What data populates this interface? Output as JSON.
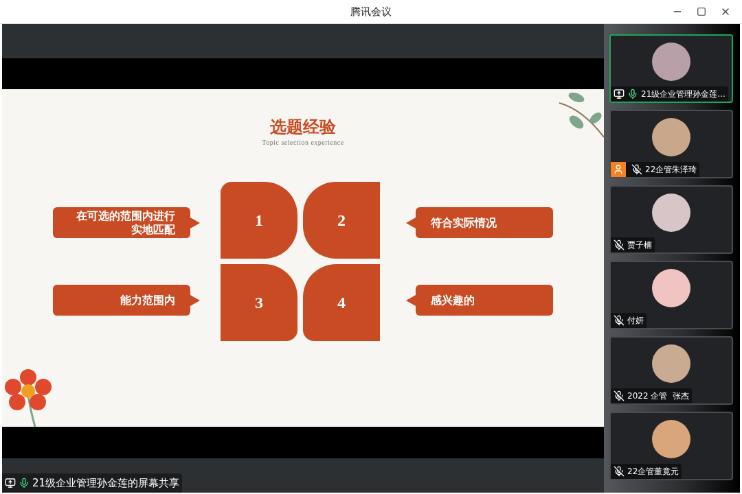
{
  "window": {
    "title": "腾讯会议"
  },
  "slide": {
    "title": "选题经验",
    "subtitle": "Topic selection experience",
    "petals": [
      "1",
      "2",
      "3",
      "4"
    ],
    "callouts_left": [
      "在可选的范围内进行实地匹配",
      "能力范围内"
    ],
    "callouts_right": [
      "符合实际情况",
      "感兴趣的"
    ]
  },
  "share_label": {
    "text": "21级企业管理孙金莲的屏幕共享",
    "sharing": true,
    "mic_on": true
  },
  "participants": [
    {
      "name": "21级企业管理孙金莲...",
      "selected": true,
      "sharing": true,
      "mic_on": true,
      "video_off_badge": false
    },
    {
      "name": "22企管朱泽琦",
      "selected": false,
      "sharing": false,
      "mic_on": false,
      "video_off_badge": true
    },
    {
      "name": "贾子楠",
      "selected": false,
      "sharing": false,
      "mic_on": false,
      "video_off_badge": false
    },
    {
      "name": "付妍",
      "selected": false,
      "sharing": false,
      "mic_on": false,
      "video_off_badge": false
    },
    {
      "name": "2022 企管  张杰",
      "selected": false,
      "sharing": false,
      "mic_on": false,
      "video_off_badge": false
    },
    {
      "name": "22企管董竟元",
      "selected": false,
      "sharing": false,
      "mic_on": false,
      "video_off_badge": false
    }
  ]
}
